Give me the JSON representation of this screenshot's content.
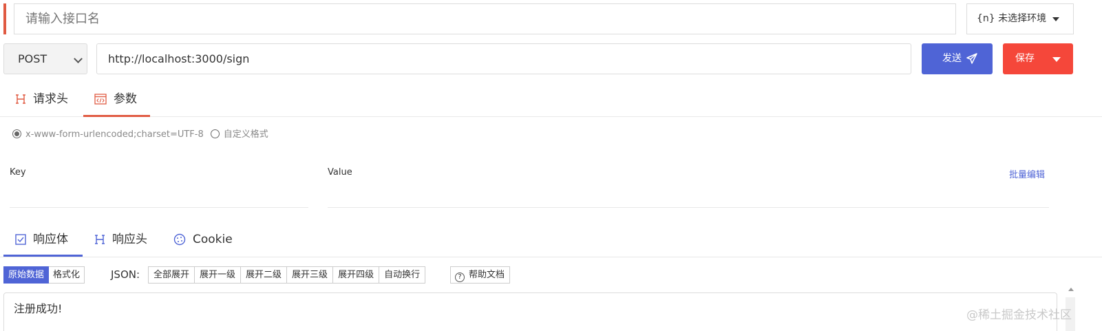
{
  "request": {
    "name_placeholder": "请输入接口名",
    "environment": "{n} 未选择环境",
    "method": "POST",
    "url": "http://localhost:3000/sign",
    "send_label": "发送",
    "save_label": "保存"
  },
  "request_tabs": [
    {
      "label": "请求头",
      "active": false
    },
    {
      "label": "参数",
      "active": true
    }
  ],
  "params": {
    "encoding_options": [
      {
        "label": "x-www-form-urlencoded;charset=UTF-8",
        "selected": true
      },
      {
        "label": "自定义格式",
        "selected": false
      }
    ],
    "key_header": "Key",
    "value_header": "Value",
    "batch_edit_label": "批量编辑"
  },
  "response_tabs": [
    {
      "label": "响应体",
      "active": true
    },
    {
      "label": "响应头",
      "active": false
    },
    {
      "label": "Cookie",
      "active": false
    }
  ],
  "toolbar": {
    "view_modes": [
      "原始数据",
      "格式化"
    ],
    "active_view_mode": "原始数据",
    "json_label": "JSON:",
    "json_actions": [
      "全部展开",
      "展开一级",
      "展开二级",
      "展开三级",
      "展开四级",
      "自动换行"
    ],
    "help_label": "帮助文档"
  },
  "response": {
    "body": "注册成功!"
  },
  "watermark": "@稀土掘金技术社区",
  "colors": {
    "accent_blue": "#4f64d6",
    "accent_red": "#f5473a",
    "tab_red": "#e05a42"
  }
}
